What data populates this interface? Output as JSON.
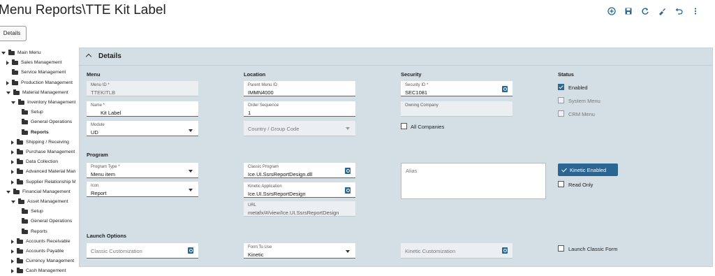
{
  "page": {
    "title": "Menu Reports\\TTE Kit Label",
    "details_button": "Details"
  },
  "toolbar": {
    "icons": [
      "add-icon",
      "save-icon",
      "refresh-icon",
      "clear-icon",
      "undo-icon",
      "more-icon"
    ]
  },
  "tree": {
    "items": [
      {
        "label": "Main Menu",
        "state": "d",
        "indent": 0
      },
      {
        "label": "Sales Management",
        "state": "r",
        "indent": 1
      },
      {
        "label": "Service Management",
        "state": "n",
        "indent": 1
      },
      {
        "label": "Production Management",
        "state": "r",
        "indent": 1
      },
      {
        "label": "Material Management",
        "state": "d",
        "indent": 1
      },
      {
        "label": "Inventory Management",
        "state": "d",
        "indent": 2
      },
      {
        "label": "Setup",
        "state": "n",
        "indent": 3
      },
      {
        "label": "General Operations",
        "state": "n",
        "indent": 3
      },
      {
        "label": "Reports",
        "state": "n",
        "indent": 3,
        "selected": true
      },
      {
        "label": "Shipping / Receiving",
        "state": "r",
        "indent": 2
      },
      {
        "label": "Purchase Management",
        "state": "r",
        "indent": 2
      },
      {
        "label": "Data Collection",
        "state": "r",
        "indent": 2
      },
      {
        "label": "Advanced Material Manag",
        "state": "r",
        "indent": 2
      },
      {
        "label": "Supplier Relationship Mar",
        "state": "r",
        "indent": 2
      },
      {
        "label": "Financial Management",
        "state": "d",
        "indent": 1
      },
      {
        "label": "Asset Management",
        "state": "d",
        "indent": 2
      },
      {
        "label": "Setup",
        "state": "n",
        "indent": 3
      },
      {
        "label": "General Operations",
        "state": "n",
        "indent": 3
      },
      {
        "label": "Reports",
        "state": "n",
        "indent": 3
      },
      {
        "label": "Accounts Receivable",
        "state": "r",
        "indent": 2
      },
      {
        "label": "Accounts Payable",
        "state": "r",
        "indent": 2
      },
      {
        "label": "Currency Management",
        "state": "r",
        "indent": 2
      },
      {
        "label": "Cash Management",
        "state": "r",
        "indent": 2
      }
    ]
  },
  "panel": {
    "title": "Details"
  },
  "sections": {
    "menu": "Menu",
    "location": "Location",
    "security": "Security",
    "status": "Status",
    "program": "Program",
    "launch": "Launch Options"
  },
  "fields": {
    "menu_id": {
      "label": "Menu ID *",
      "value": "TTEKITLB"
    },
    "name": {
      "label": "Name *",
      "value": "Kit Label"
    },
    "module": {
      "label": "Module",
      "value": "UD"
    },
    "parent_menu_id": {
      "label": "Parent Menu ID",
      "value": "IMMN4000"
    },
    "order_sequence": {
      "label": "Order Sequence",
      "value": "1"
    },
    "country_group_code": {
      "placeholder": "Country / Group Code"
    },
    "security_id": {
      "label": "Security ID *",
      "value": "SEC1081"
    },
    "owning_company": {
      "label": "Owning Company",
      "value": ""
    },
    "program_type": {
      "label": "Program Type *",
      "value": "Menu item"
    },
    "icon": {
      "label": "Icon",
      "value": "Report"
    },
    "classic_program": {
      "label": "Classic Program",
      "value": "Ice.UI.SsrsReportDesign.dll"
    },
    "kinetic_application": {
      "label": "Kinetic Application",
      "value": "Ice.UI.SsrsReportDesign"
    },
    "url": {
      "label": "URL",
      "value": "metafx/#/view/Ice.UI.SsrsReportDesign"
    },
    "alias": {
      "placeholder": "Alias"
    },
    "classic_customization": {
      "placeholder": "Classic Customization"
    },
    "form_to_use": {
      "label": "Form To Use",
      "value": "Kinetic"
    },
    "kinetic_customization": {
      "placeholder": "Kinetic Customization"
    }
  },
  "checks": {
    "all_companies": "All Companies",
    "enabled": "Enabled",
    "system_menu": "System Menu",
    "crm_menu": "CRM Menu",
    "kinetic_enabled": "Kinetic Enabled",
    "read_only": "Read Only",
    "launch_classic_form": "Launch Classic Form"
  },
  "colors": {
    "accent": "#2b6693",
    "panel": "#d3dfe4"
  }
}
